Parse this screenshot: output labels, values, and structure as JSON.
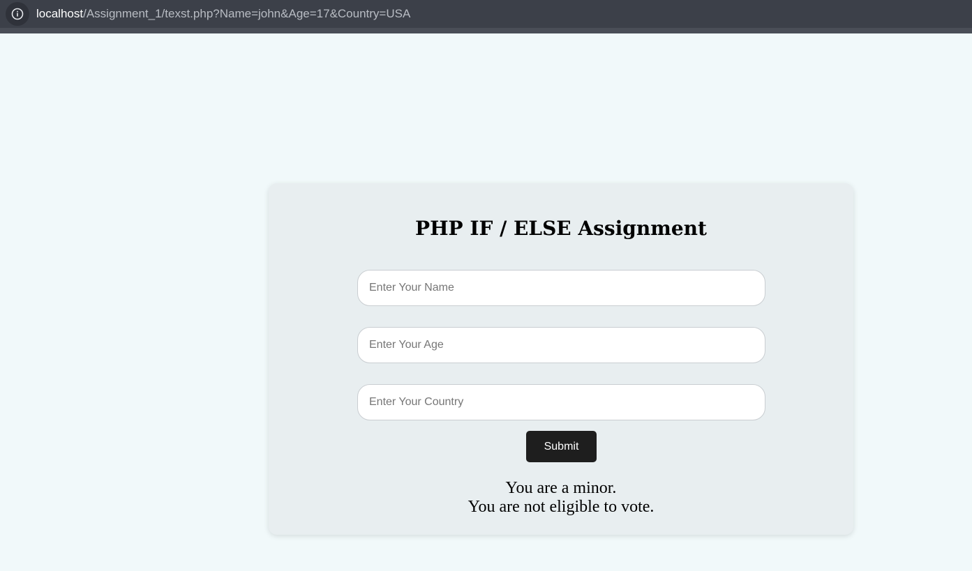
{
  "browser": {
    "url_host": "localhost",
    "url_path": "/Assignment_1/texst.php?Name=john&Age=17&Country=USA",
    "info_icon": "info-icon"
  },
  "form": {
    "title": "PHP IF / ELSE Assignment",
    "name_placeholder": "Enter Your Name",
    "age_placeholder": "Enter Your Age",
    "country_placeholder": "Enter Your Country",
    "submit_label": "Submit"
  },
  "result": {
    "line1": "You are a minor.",
    "line2": "You are not eligible to vote."
  },
  "colors": {
    "page_background": "#f1f9fa",
    "card_background": "#e8eef0",
    "browser_bar": "#3c4049",
    "button": "#1e1e1e"
  }
}
